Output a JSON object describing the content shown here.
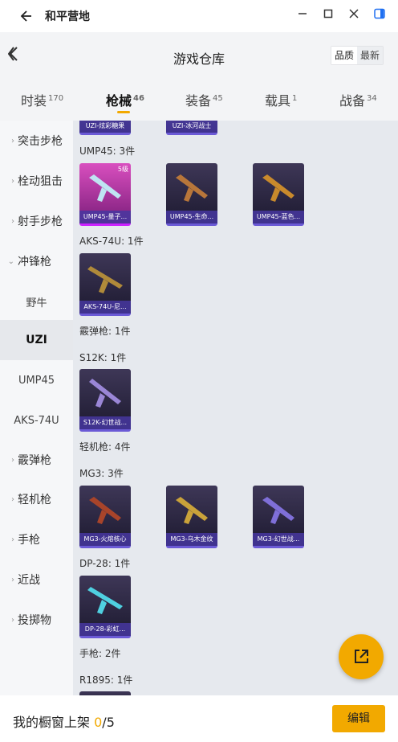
{
  "app": {
    "title": "和平营地"
  },
  "window_controls": {
    "minimize_icon": "minimize-icon",
    "maximize_icon": "maximize-icon",
    "close_icon": "close-icon",
    "sidebar_icon": "sidebar-toggle-icon"
  },
  "header": {
    "title": "游戏仓库",
    "sort": {
      "options": [
        "品质",
        "最新"
      ],
      "selected": "品质"
    }
  },
  "tabs": [
    {
      "label": "时装",
      "count": "170"
    },
    {
      "label": "枪械",
      "count": "46"
    },
    {
      "label": "装备",
      "count": "45"
    },
    {
      "label": "载具",
      "count": "1"
    },
    {
      "label": "战备",
      "count": "34"
    }
  ],
  "sidebar": {
    "items": [
      {
        "label": "突击步枪",
        "expanded": false
      },
      {
        "label": "栓动狙击",
        "expanded": false
      },
      {
        "label": "射手步枪",
        "expanded": false
      },
      {
        "label": "冲锋枪",
        "expanded": true
      },
      {
        "label": "野牛"
      },
      {
        "label": "UZI"
      },
      {
        "label": "UMP45"
      },
      {
        "label": "AKS-74U"
      },
      {
        "label": "霰弹枪",
        "expanded": false
      },
      {
        "label": "轻机枪",
        "expanded": false
      },
      {
        "label": "手枪",
        "expanded": false
      },
      {
        "label": "近战",
        "expanded": false
      },
      {
        "label": "投掷物",
        "expanded": false
      }
    ],
    "selected": "UZI"
  },
  "content": {
    "top_cards": [
      "UZI-炫彩糖果",
      "UZI-冰河战士"
    ],
    "groups": [
      {
        "title": "UMP45: 3件",
        "cards": [
          {
            "label": "UMP45-量子...",
            "badge": "5级"
          },
          {
            "label": "UMP45-生命..."
          },
          {
            "label": "UMP45-蓝色..."
          }
        ]
      },
      {
        "title": "AKS-74U: 1件",
        "cards": [
          {
            "label": "AKS-74U-尼..."
          }
        ]
      },
      {
        "title": "霰弹枪: 1件",
        "cards": []
      },
      {
        "title": "S12K: 1件",
        "cards": [
          {
            "label": "S12K-幻世战..."
          }
        ]
      },
      {
        "title": "轻机枪: 4件",
        "cards": []
      },
      {
        "title": "MG3: 3件",
        "cards": [
          {
            "label": "MG3-火熔核心"
          },
          {
            "label": "MG3-乌木金纹"
          },
          {
            "label": "MG3-幻世战..."
          }
        ]
      },
      {
        "title": "DP-28: 1件",
        "cards": [
          {
            "label": "DP-28-彩虹..."
          }
        ]
      },
      {
        "title": "手枪: 2件",
        "cards": []
      },
      {
        "title": "R1895: 1件",
        "cards": []
      }
    ]
  },
  "bottom": {
    "text": "我的橱窗上架",
    "count_current": "0",
    "count_total": "/5",
    "edit_label": "编辑"
  },
  "fab": {
    "icon": "share-icon"
  },
  "colors": {
    "accent": "#f2a900",
    "card_label": "#4637a0"
  }
}
